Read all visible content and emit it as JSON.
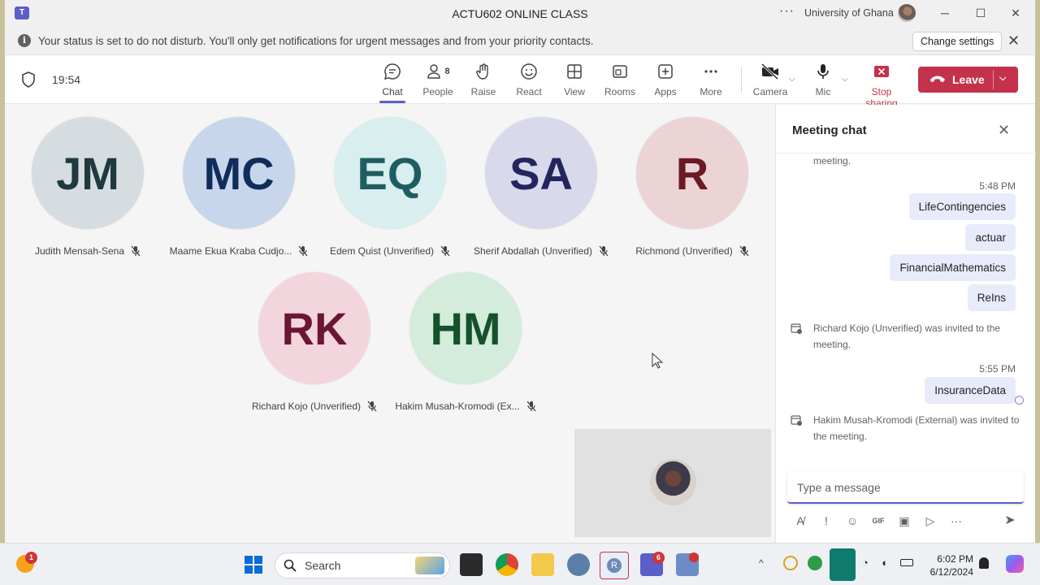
{
  "window": {
    "title": "ACTU602 ONLINE CLASS",
    "org": "University of Ghana",
    "more": "···",
    "minimize": "─",
    "maximize": "☐",
    "close": "✕"
  },
  "notification": {
    "text": "Your status is set to do not disturb. You'll only get notifications for urgent messages and from your priority contacts.",
    "button": "Change settings",
    "icon": "i",
    "close": "✕"
  },
  "toolbar": {
    "timer": "19:54",
    "people_count": "8",
    "items": [
      {
        "label": "Chat"
      },
      {
        "label": "People"
      },
      {
        "label": "Raise"
      },
      {
        "label": "React"
      },
      {
        "label": "View"
      },
      {
        "label": "Rooms"
      },
      {
        "label": "Apps"
      },
      {
        "label": "More"
      },
      {
        "label": "Camera"
      },
      {
        "label": "Mic"
      },
      {
        "label": "Stop sharing"
      }
    ],
    "leave": "Leave",
    "accent": "#5b5fc7",
    "stop_color": "#c4314b"
  },
  "participants": [
    {
      "initials": "JM",
      "name": "Judith Mensah-Sena",
      "bg": "#d6dde1",
      "fg": "#1e3a3f"
    },
    {
      "initials": "MC",
      "name": "Maame Ekua Kraba Cudjo...",
      "bg": "#c7d6ea",
      "fg": "#0f2c5a"
    },
    {
      "initials": "EQ",
      "name": "Edem Quist (Unverified)",
      "bg": "#d9eeef",
      "fg": "#1f5e60"
    },
    {
      "initials": "SA",
      "name": "Sherif Abdallah (Unverified)",
      "bg": "#d8d9ea",
      "fg": "#23265e"
    },
    {
      "initials": "R",
      "name": "Richmond (Unverified)",
      "bg": "#ecd4d6",
      "fg": "#6a1a24"
    },
    {
      "initials": "RK",
      "name": "Richard Kojo (Unverified)",
      "bg": "#f3d6dd",
      "fg": "#6b1632"
    },
    {
      "initials": "HM",
      "name": "Hakim Musah-Kromodi (Ex...",
      "bg": "#d3ecdb",
      "fg": "#15522c"
    }
  ],
  "chat": {
    "title": "Meeting chat",
    "close": "✕",
    "top_cut": "meeting.",
    "ts1": "5:48 PM",
    "bubbles1": [
      "LifeContingencies",
      "actuar",
      "FinancialMathematics",
      "ReIns"
    ],
    "sys1": "Richard Kojo (Unverified) was invited to the meeting.",
    "ts2": "5:55 PM",
    "bubble2": "InsuranceData",
    "sys2": "Hakim Musah-Kromodi (External) was invited to the meeting.",
    "placeholder": "Type a message"
  },
  "taskbar": {
    "search": "Search",
    "badge_left": "1",
    "badge_teams": "6",
    "time": "6:02 PM",
    "date": "6/12/2024"
  }
}
